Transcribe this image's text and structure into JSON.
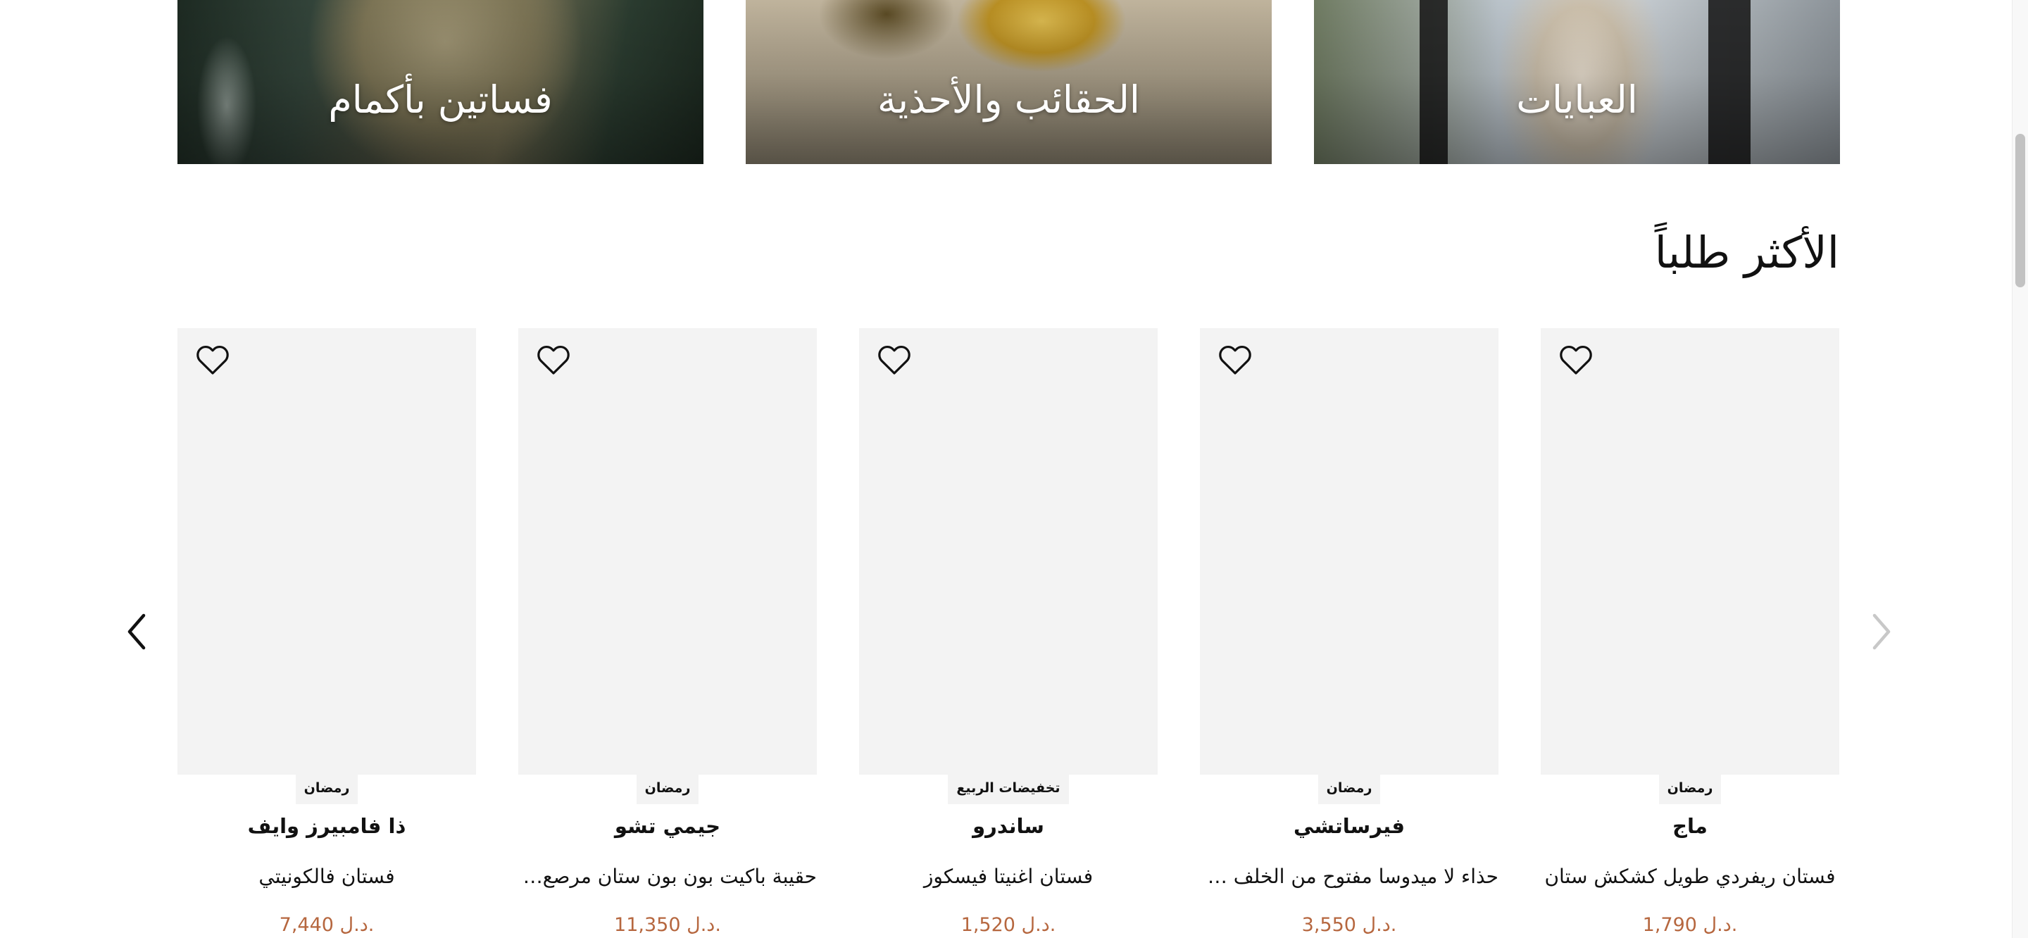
{
  "categories": [
    {
      "label": "فساتين بأكمام",
      "icon": "dresses-image"
    },
    {
      "label": "الحقائب والأحذية",
      "icon": "bags-shoes-image"
    },
    {
      "label": "العبايات",
      "icon": "abayas-image"
    }
  ],
  "section": {
    "title": "الأكثر طلباً"
  },
  "products": [
    {
      "badge": "رمضان",
      "brand": "ماج",
      "name": "فستان ريفردي طويل كشكش ستان",
      "price": "1,790 د.ل."
    },
    {
      "badge": "رمضان",
      "brand": "فيرساتشي",
      "name": "حذاء لا ميدوسا مفتوح من الخلف ومزين",
      "price": "3,550 د.ل."
    },
    {
      "badge": "تخفيضات الربيع",
      "brand": "ساندرو",
      "name": "فستان اغنيتا فيسكوز",
      "price": "1,520 د.ل."
    },
    {
      "badge": "رمضان",
      "brand": "جيمي تشو",
      "name": "حقيبة باكيت بون بون ستان مرصع بالكريستال",
      "price": "11,350 د.ل."
    },
    {
      "badge": "رمضان",
      "brand": "ذا فامبيرز وايف",
      "name": "فستان فالكونيتي",
      "price": "7,440 د.ل."
    }
  ],
  "carousel": {
    "prev_icon": "chevron-left-icon",
    "next_icon": "chevron-right-icon"
  },
  "colors": {
    "accent_price": "#b6673f",
    "card_bg": "#f3f3f3"
  }
}
